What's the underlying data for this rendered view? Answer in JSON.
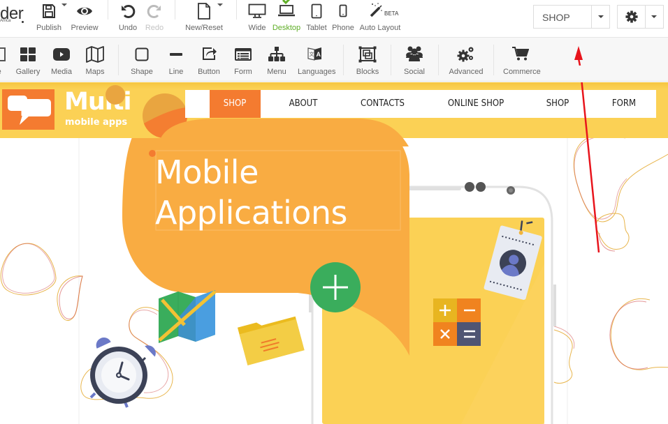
{
  "app": {
    "logo_text": "der",
    "logo_sub": "Africa"
  },
  "toolbar_top": {
    "items": [
      {
        "id": "publish",
        "label": "Publish",
        "icon": "save-icon",
        "has_dropdown": true
      },
      {
        "id": "preview",
        "label": "Preview",
        "icon": "eye-icon"
      },
      {
        "id": "undo",
        "label": "Undo",
        "icon": "undo-icon"
      },
      {
        "id": "redo",
        "label": "Redo",
        "icon": "redo-icon",
        "disabled": true
      },
      {
        "id": "new_reset",
        "label": "New/Reset",
        "icon": "file-icon",
        "has_dropdown": true
      },
      {
        "id": "wide",
        "label": "Wide",
        "icon": "monitor-icon"
      },
      {
        "id": "desktop",
        "label": "Desktop",
        "icon": "laptop-icon",
        "active": true
      },
      {
        "id": "tablet",
        "label": "Tablet",
        "icon": "tablet-icon"
      },
      {
        "id": "phone",
        "label": "Phone",
        "icon": "phone-icon"
      },
      {
        "id": "auto_layout",
        "label": "Auto Layout",
        "icon": "magic-wand-icon",
        "badge": "BETA"
      }
    ],
    "page_select": {
      "value": "SHOP"
    },
    "settings": {
      "icon": "gear-icon"
    }
  },
  "toolbar_elements": {
    "items": [
      {
        "id": "picture",
        "label": "re",
        "icon": "picture-icon"
      },
      {
        "id": "gallery",
        "label": "Gallery",
        "icon": "gallery-icon"
      },
      {
        "id": "media",
        "label": "Media",
        "icon": "youtube-icon"
      },
      {
        "id": "maps",
        "label": "Maps",
        "icon": "map-icon"
      },
      {
        "id": "shape",
        "label": "Shape",
        "icon": "square-icon"
      },
      {
        "id": "line",
        "label": "Line",
        "icon": "line-icon"
      },
      {
        "id": "button",
        "label": "Button",
        "icon": "share-button-icon"
      },
      {
        "id": "form",
        "label": "Form",
        "icon": "form-icon"
      },
      {
        "id": "menu",
        "label": "Menu",
        "icon": "sitemap-icon"
      },
      {
        "id": "languages",
        "label": "Languages",
        "icon": "translate-icon"
      },
      {
        "id": "blocks",
        "label": "Blocks",
        "icon": "blocks-icon"
      },
      {
        "id": "social",
        "label": "Social",
        "icon": "users-icon"
      },
      {
        "id": "advanced",
        "label": "Advanced",
        "icon": "cogs-icon"
      },
      {
        "id": "commerce",
        "label": "Commerce",
        "icon": "cart-icon"
      }
    ]
  },
  "site": {
    "brand_name": "Multi",
    "brand_tagline": "mobile apps",
    "nav": [
      "SHOP",
      "ABOUT",
      "CONTACTS",
      "ONLINE SHOP",
      "SHOP",
      "FORM"
    ],
    "nav_active_index": 0,
    "hero_title_line1": "Mobile",
    "hero_title_line2": "Applications"
  },
  "colors": {
    "header_yellow": "#fbd155",
    "accent_orange": "#f47b30",
    "bubble_orange": "#f9ac42",
    "desktop_active_green": "#5fae27",
    "annotation_red": "#e8141c",
    "plus_green": "#3aad5c"
  }
}
